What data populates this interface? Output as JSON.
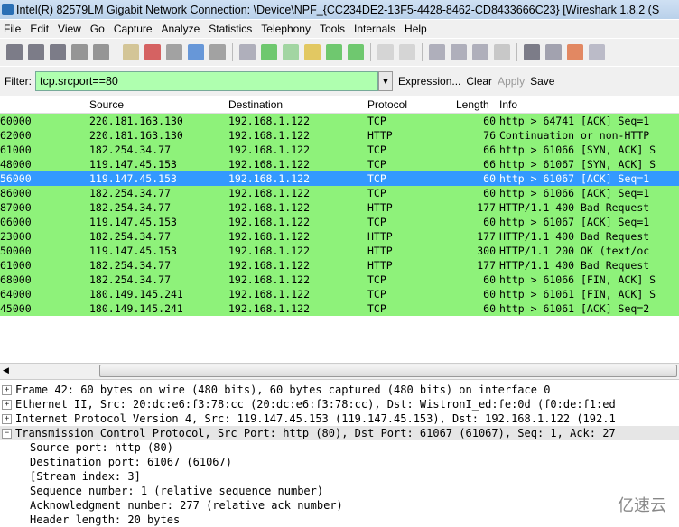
{
  "window": {
    "title": "Intel(R) 82579LM Gigabit Network Connection: \\Device\\NPF_{CC234DE2-13F5-4428-8462-CD8433666C23}   [Wireshark 1.8.2  (S"
  },
  "menu": [
    "File",
    "Edit",
    "View",
    "Go",
    "Capture",
    "Analyze",
    "Statistics",
    "Telephony",
    "Tools",
    "Internals",
    "Help"
  ],
  "toolbar_icons": [
    "interfaces-icon",
    "options-icon",
    "start-icon",
    "stop-icon",
    "restart-icon",
    "open-icon",
    "save-icon",
    "close-icon",
    "reload-icon",
    "print-icon",
    "find-icon",
    "back-icon",
    "forward-icon",
    "goto-icon",
    "first-icon",
    "last-icon",
    "colorize-icon",
    "autoscroll-icon",
    "zoom-in-icon",
    "zoom-out-icon",
    "normal-size-icon",
    "resize-columns-icon",
    "capture-filters-icon",
    "display-filters-icon",
    "coloring-rules-icon",
    "preferences-icon"
  ],
  "filter": {
    "label": "Filter:",
    "value": "tcp.srcport==80",
    "expression": "Expression...",
    "clear": "Clear",
    "apply": "Apply",
    "save": "Save"
  },
  "columns": [
    "",
    "Source",
    "Destination",
    "Protocol",
    "Length",
    "Info"
  ],
  "packets": [
    [
      "60000",
      "220.181.163.130",
      "192.168.1.122",
      "TCP",
      "60",
      "http > 64741 [ACK] Seq=1"
    ],
    [
      "62000",
      "220.181.163.130",
      "192.168.1.122",
      "HTTP",
      "76",
      "Continuation or non-HTTP"
    ],
    [
      "61000",
      "182.254.34.77",
      "192.168.1.122",
      "TCP",
      "66",
      "http > 61066 [SYN, ACK] S"
    ],
    [
      "48000",
      "119.147.45.153",
      "192.168.1.122",
      "TCP",
      "66",
      "http > 61067 [SYN, ACK] S"
    ],
    [
      "56000",
      "119.147.45.153",
      "192.168.1.122",
      "TCP",
      "60",
      "http > 61067 [ACK] Seq=1"
    ],
    [
      "86000",
      "182.254.34.77",
      "192.168.1.122",
      "TCP",
      "60",
      "http > 61066 [ACK] Seq=1"
    ],
    [
      "87000",
      "182.254.34.77",
      "192.168.1.122",
      "HTTP",
      "177",
      "HTTP/1.1 400 Bad Request"
    ],
    [
      "06000",
      "119.147.45.153",
      "192.168.1.122",
      "TCP",
      "60",
      "http > 61067 [ACK] Seq=1"
    ],
    [
      "23000",
      "182.254.34.77",
      "192.168.1.122",
      "HTTP",
      "177",
      "HTTP/1.1 400 Bad Request"
    ],
    [
      "50000",
      "119.147.45.153",
      "192.168.1.122",
      "HTTP",
      "300",
      "HTTP/1.1 200 OK  (text/oc"
    ],
    [
      "61000",
      "182.254.34.77",
      "192.168.1.122",
      "HTTP",
      "177",
      "HTTP/1.1 400 Bad Request"
    ],
    [
      "68000",
      "182.254.34.77",
      "192.168.1.122",
      "TCP",
      "60",
      "http > 61066 [FIN, ACK] S"
    ],
    [
      "64000",
      "180.149.145.241",
      "192.168.1.122",
      "TCP",
      "60",
      "http > 61061 [FIN, ACK] S"
    ],
    [
      "45000",
      "180.149.145.241",
      "192.168.1.122",
      "TCP",
      "60",
      "http > 61061 [ACK] Seq=2"
    ]
  ],
  "selected_row": 4,
  "colors": {
    "row_green": "#8ef27a",
    "selected": "#3399ff",
    "filter_bg": "#afffaf"
  },
  "details": {
    "top": [
      {
        "text": "Frame 42: 60 bytes on wire (480 bits), 60 bytes captured (480 bits) on interface 0",
        "expanded": false
      },
      {
        "text": "Ethernet II, Src: 20:dc:e6:f3:78:cc (20:dc:e6:f3:78:cc), Dst: WistronI_ed:fe:0d (f0:de:f1:ed",
        "expanded": false
      },
      {
        "text": "Internet Protocol Version 4, Src: 119.147.45.153 (119.147.45.153), Dst: 192.168.1.122 (192.1",
        "expanded": false
      },
      {
        "text": "Transmission Control Protocol, Src Port: http (80), Dst Port: 61067 (61067), Seq: 1, Ack: 27",
        "expanded": true
      }
    ],
    "children": [
      "Source port: http (80)",
      "Destination port: 61067 (61067)",
      "[Stream index: 3]",
      "Sequence number: 1    (relative sequence number)",
      "Acknowledgment number: 277    (relative ack number)",
      "Header length: 20 bytes"
    ]
  },
  "watermark": "亿速云"
}
